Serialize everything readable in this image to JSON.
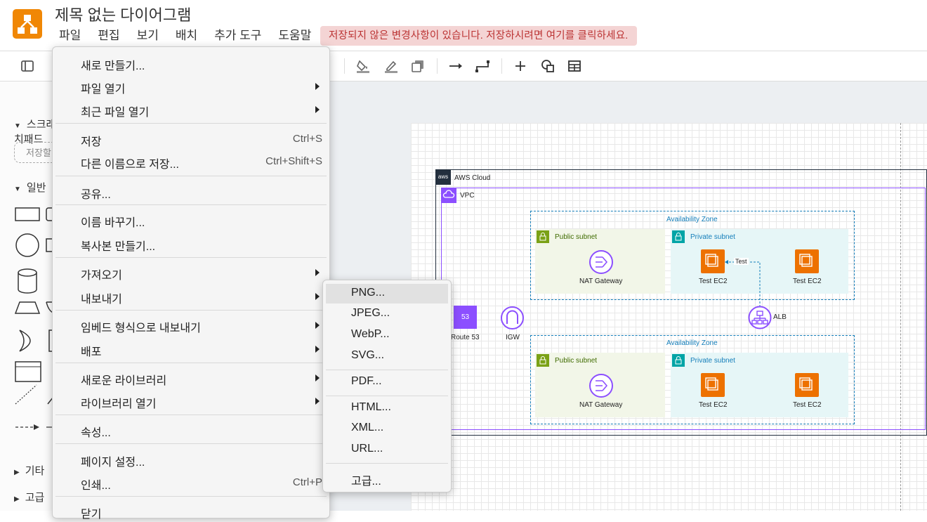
{
  "app": {
    "title": "제목 없는 다이어그램",
    "menubar": [
      "파일",
      "편집",
      "보기",
      "배치",
      "추가 도구",
      "도움말"
    ],
    "unsaved_notice": "저장되지 않은 변경사항이 있습니다. 저장하시려면 여기를 클릭하세요.",
    "accent_color": "#f08705",
    "notice_color": "#f4d4d4"
  },
  "toolbar": {
    "icons": [
      "sidebar-toggle-icon",
      "fill-color-icon",
      "line-color-icon",
      "shadow-icon",
      "connection-arrow-icon",
      "waypoint-icon",
      "insert-plus-icon",
      "shape-icon",
      "table-icon"
    ]
  },
  "sidebar": {
    "scratchpad_label": "스크래치패드",
    "search_placeholder": "저장할",
    "general_label": "일반",
    "misc_label": "기타",
    "advanced_label": "고급"
  },
  "file_menu": {
    "items": [
      {
        "label": "새로 만들기...",
        "shortcut": "",
        "submenu": false
      },
      {
        "label": "파일 열기",
        "shortcut": "",
        "submenu": true
      },
      {
        "label": "최근 파일 열기",
        "shortcut": "",
        "submenu": true
      },
      {
        "label": "저장",
        "shortcut": "Ctrl+S",
        "submenu": false
      },
      {
        "label": "다른 이름으로 저장...",
        "shortcut": "Ctrl+Shift+S",
        "submenu": false
      },
      {
        "label": "공유...",
        "shortcut": "",
        "submenu": false
      },
      {
        "label": "이름 바꾸기...",
        "shortcut": "",
        "submenu": false
      },
      {
        "label": "복사본 만들기...",
        "shortcut": "",
        "submenu": false
      },
      {
        "label": "가져오기",
        "shortcut": "",
        "submenu": true
      },
      {
        "label": "내보내기",
        "shortcut": "",
        "submenu": true
      },
      {
        "label": "임베드 형식으로 내보내기",
        "shortcut": "",
        "submenu": true
      },
      {
        "label": "배포",
        "shortcut": "",
        "submenu": true
      },
      {
        "label": "새로운 라이브러리",
        "shortcut": "",
        "submenu": true
      },
      {
        "label": "라이브러리 열기",
        "shortcut": "",
        "submenu": true
      },
      {
        "label": "속성...",
        "shortcut": "",
        "submenu": false
      },
      {
        "label": "페이지 설정...",
        "shortcut": "",
        "submenu": false
      },
      {
        "label": "인쇄...",
        "shortcut": "Ctrl+P",
        "submenu": false
      },
      {
        "label": "닫기",
        "shortcut": "",
        "submenu": false
      }
    ]
  },
  "export_submenu": {
    "items": [
      "PNG...",
      "JPEG...",
      "WebP...",
      "SVG...",
      "PDF...",
      "HTML...",
      "XML...",
      "URL...",
      "고급..."
    ],
    "highlighted": "PNG..."
  },
  "diagram": {
    "aws_cloud": "AWS Cloud",
    "vpc": "VPC",
    "az_label": "Availability Zone",
    "public_subnet": "Public subnet",
    "private_subnet": "Private subnet",
    "nat_gateway": "NAT Gateway",
    "ec2": "Test EC2",
    "route53": "Route 53",
    "route53_badge": "53",
    "igw": "IGW",
    "alb": "ALB",
    "edge_label": "Test",
    "aws_badge": "aws"
  }
}
